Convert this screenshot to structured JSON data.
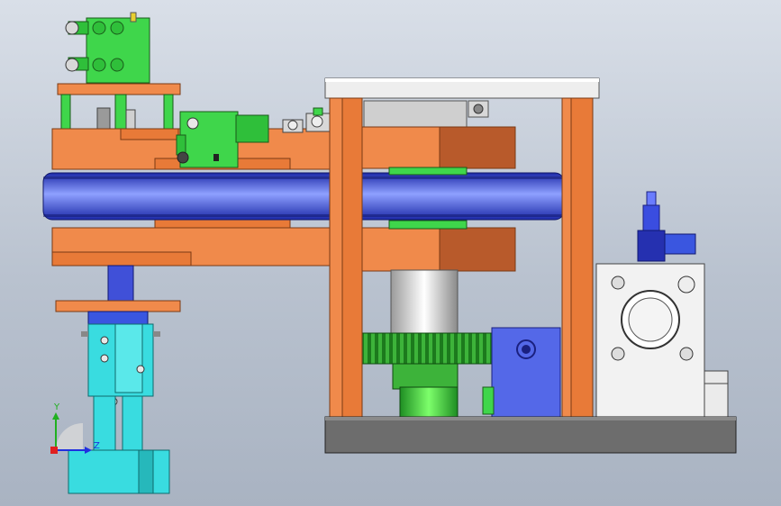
{
  "viewport": {
    "background_top": "#d9dfe8",
    "background_bottom": "#a9b3c2"
  },
  "colors": {
    "orange_plate": "#f08a4b",
    "orange_dark": "#c8642f",
    "green_part": "#3fd64b",
    "cyan_part": "#39dce0",
    "blue_belt": "#3a56e0",
    "blue_block": "#5468e8",
    "grey_base": "#6d6d6d",
    "steel": "#c8c8c8",
    "white_housing": "#f2f2f2"
  },
  "triad": {
    "y_label": "Y",
    "z_label": "Z",
    "x_axis_color": "#e02020",
    "y_axis_color": "#20b020",
    "z_axis_color": "#2030e0"
  }
}
